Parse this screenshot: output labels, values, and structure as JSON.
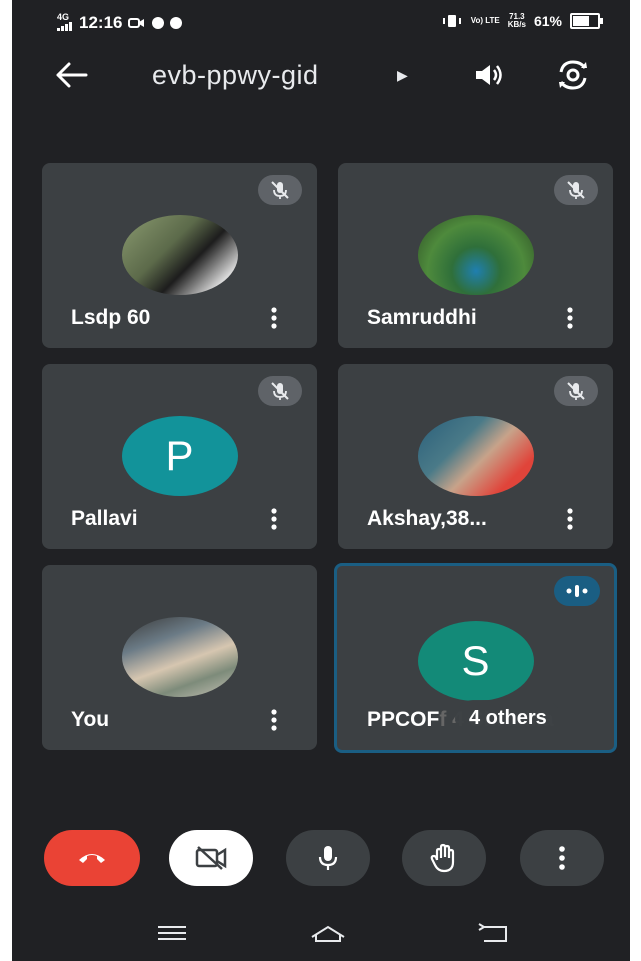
{
  "status_bar": {
    "network": "4G",
    "time": "12:16",
    "volte": "Vo) LTE",
    "speed_value": "71.3",
    "speed_unit": "KB/s",
    "battery": "61%"
  },
  "header": {
    "meeting_code": "evb-ppwy-gid"
  },
  "participants": [
    {
      "name": "Lsdp 60",
      "muted": true,
      "avatar": "photo",
      "avatar_colors": [
        "#7a8a6a",
        "#2b2b2b"
      ]
    },
    {
      "name": "Samruddhi",
      "muted": true,
      "avatar": "photo",
      "avatar_colors": [
        "#3e6b3a",
        "#1f7fb0"
      ]
    },
    {
      "name": "Pallavi",
      "muted": true,
      "avatar": "letter",
      "letter": "P",
      "avatar_color": "#12939a"
    },
    {
      "name": "Akshay,38...",
      "muted": true,
      "avatar": "photo",
      "avatar_colors": [
        "#e0443a",
        "#2a5f7a"
      ]
    },
    {
      "name": "You",
      "muted": false,
      "avatar": "photo",
      "avatar_colors": [
        "#6b7b86",
        "#c9c4b8"
      ]
    },
    {
      "name": "PPCOF",
      "name_overflow": "f 4 Shrutika",
      "muted": false,
      "speaking": true,
      "avatar": "letter",
      "letter": "S",
      "avatar_color": "#138a78",
      "others_label": "4 others"
    }
  ],
  "controls": [
    "end-call",
    "camera-off",
    "microphone",
    "raise-hand",
    "more-options"
  ],
  "colors": {
    "background": "#202124",
    "tile": "#3c4043",
    "end_call": "#ea4335",
    "active_border": "#1a5e83"
  }
}
